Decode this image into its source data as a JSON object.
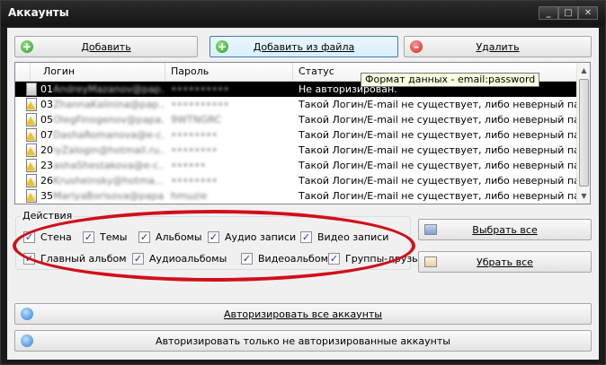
{
  "window": {
    "title": "Аккаунты",
    "controls": [
      "minimize",
      "maximize",
      "close"
    ]
  },
  "toolbar": {
    "add_label": "Добавить",
    "add_from_file_label": "Добавить из файла",
    "delete_label": "Удалить"
  },
  "tooltip": "Формат данных - email:password",
  "table": {
    "columns": [
      "Логин",
      "Пароль",
      "Статус"
    ],
    "rows": [
      {
        "login": "01AndreyMazanov@pap...",
        "password": "••••••••••",
        "status": "Не авторизирован.",
        "icon": "plain",
        "selected": true
      },
      {
        "login": "03ZhannaKalinina@pap...",
        "password": "••••••••••",
        "status": "Такой Логин/E-mail не существует, либо неверный пароль.",
        "icon": "warning"
      },
      {
        "login": "05OlegFinogenov@papa...",
        "password": "9WTNGRC",
        "status": "Такой Логин/E-mail не существует, либо неверный пароль.",
        "icon": "warning"
      },
      {
        "login": "07DashaRomanova@e-c...",
        "password": "••••••••",
        "status": "Такой Логин/E-mail не существует, либо неверный пароль.",
        "icon": "warning"
      },
      {
        "login": "20iyZalogin@hotmail.ru...",
        "password": "••••••••",
        "status": "Такой Логин/E-mail не существует, либо неверный пароль.",
        "icon": "warning"
      },
      {
        "login": "23ashaShestakova@e-c...",
        "password": "••••••",
        "status": "Такой Логин/E-mail не существует, либо неверный пароль.",
        "icon": "warning"
      },
      {
        "login": "26Krusheinsky@hotma...",
        "password": "••••••••",
        "status": "Такой Логин/E-mail не существует, либо неверный пароль.",
        "icon": "warning"
      },
      {
        "login": "35MariyaBorisova@papa...",
        "password": "hmuzie",
        "status": "Такой Логин/E-mail не существует, либо неверный пароль.",
        "icon": "warning"
      }
    ]
  },
  "actions": {
    "group_title": "Действия",
    "checkboxes": [
      {
        "label": "Стена",
        "checked": true
      },
      {
        "label": "Темы",
        "checked": true
      },
      {
        "label": "Альбомы",
        "checked": true
      },
      {
        "label": "Аудио записи",
        "checked": true
      },
      {
        "label": "Видео записи",
        "checked": true
      },
      {
        "label": "Главный альбом",
        "checked": true
      },
      {
        "label": "Аудиоальбомы",
        "checked": true
      },
      {
        "label": "Видеоальбомы",
        "checked": true
      },
      {
        "label": "Группы-друзья",
        "checked": true
      }
    ]
  },
  "side_buttons": {
    "select_all": "Выбрать все",
    "deselect_all": "Убрать все"
  },
  "bottom_buttons": {
    "authorize_all": "Авторизировать все аккаунты",
    "authorize_unauthorized": "Авторизировать только не авторизированные аккаунты"
  },
  "colors": {
    "selection": "#000000",
    "highlight_oval": "#d0101a",
    "tooltip_bg": "#ffffe1"
  }
}
